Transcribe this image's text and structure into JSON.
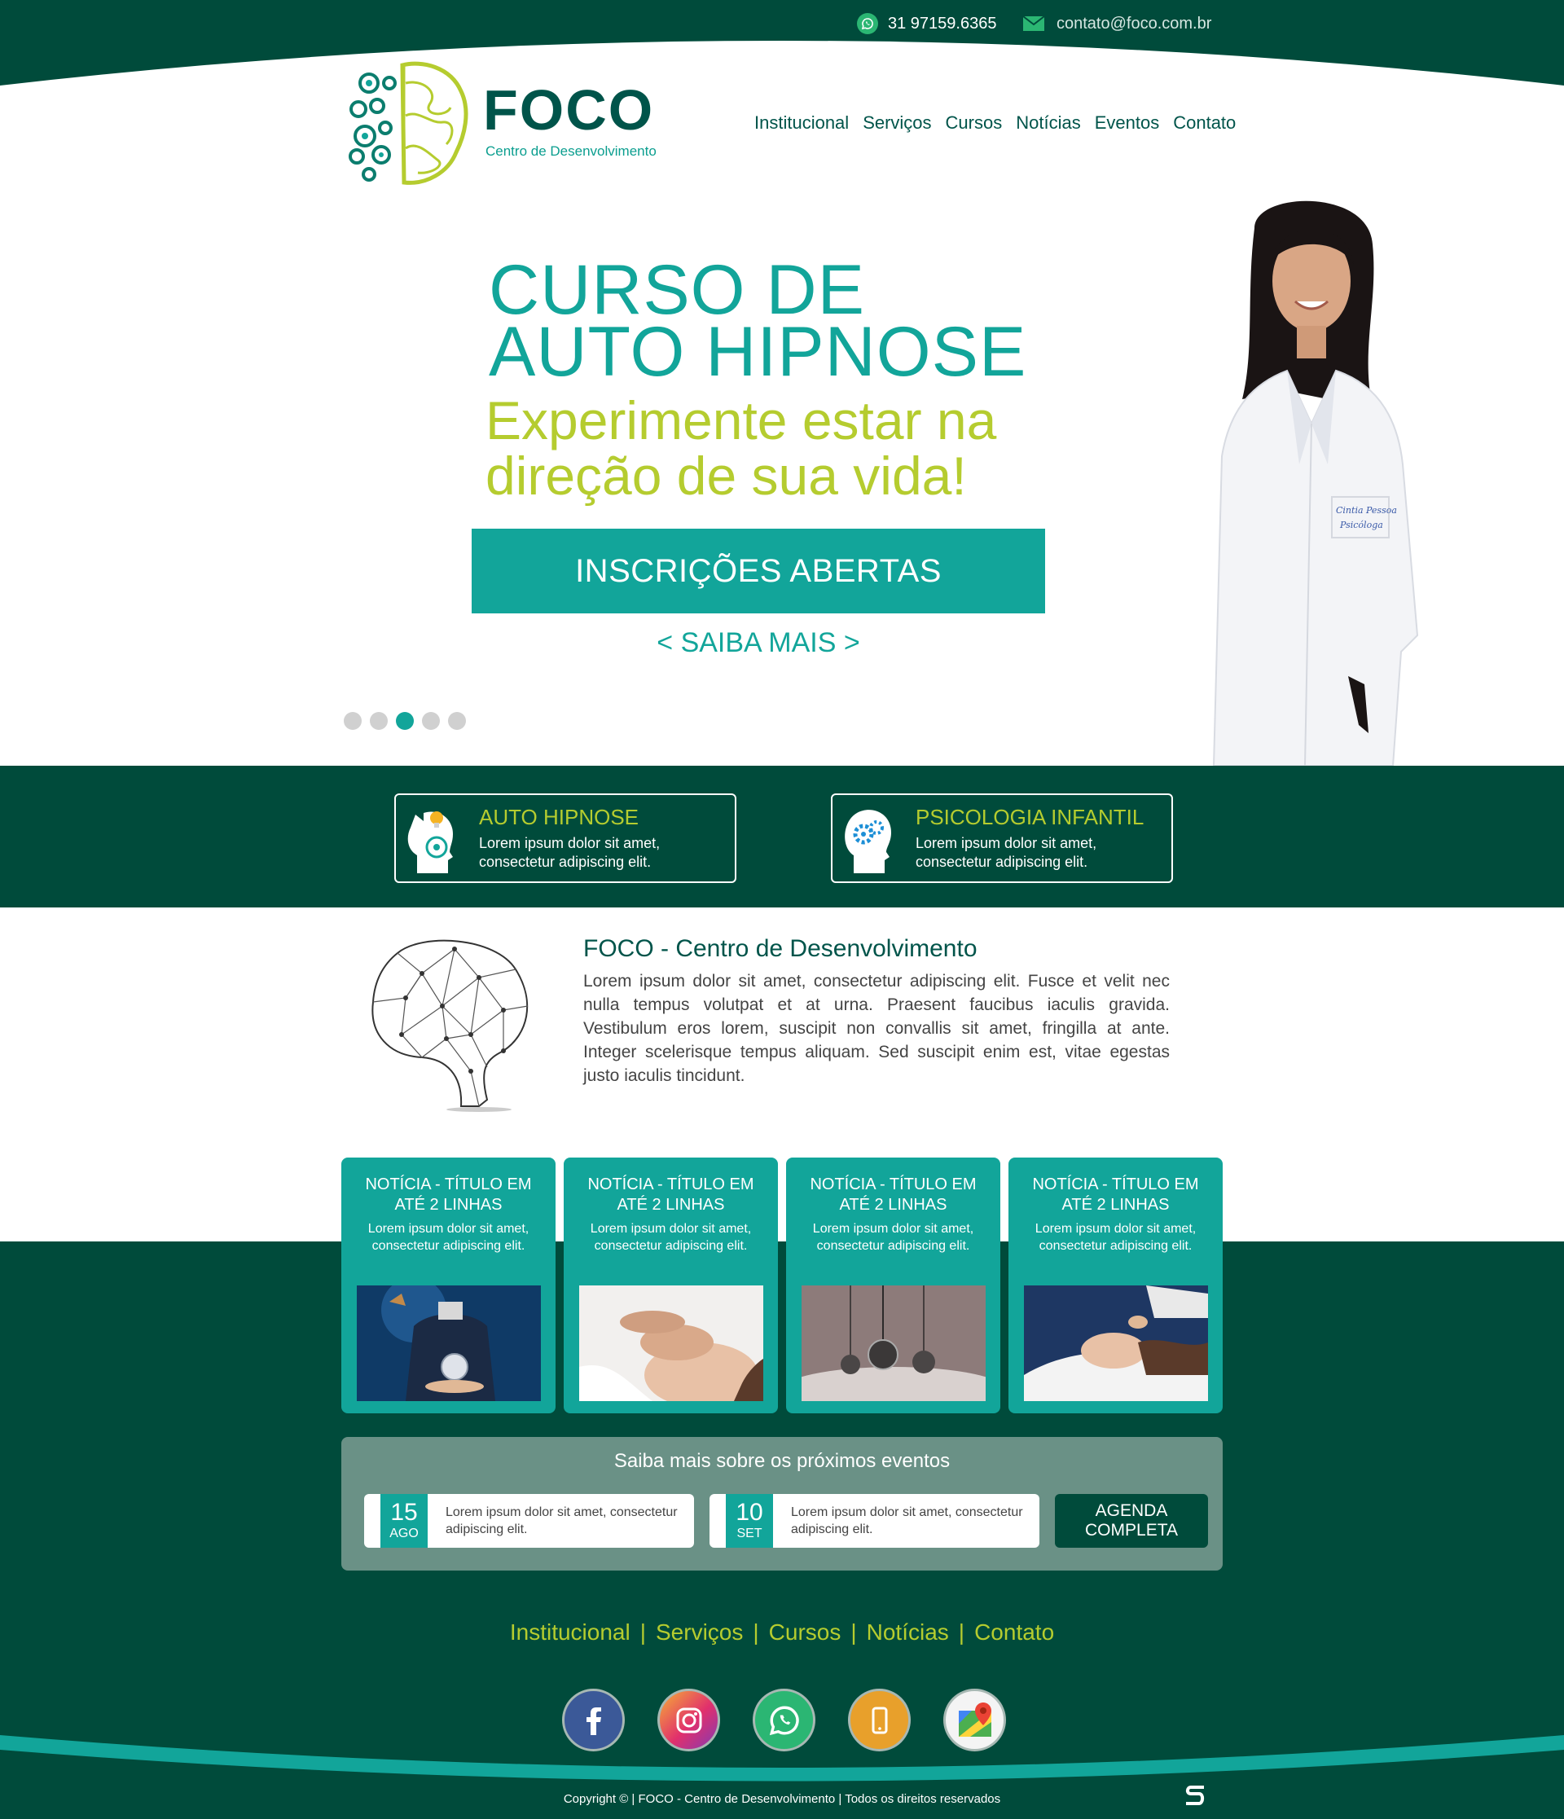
{
  "topbar": {
    "phone": "31 97159.6365",
    "email": "contato@foco.com.br",
    "phone_icon": "whatsapp-icon",
    "email_icon": "mail-icon"
  },
  "brand": {
    "name": "FOCO",
    "tagline": "Centro de Desenvolvimento"
  },
  "nav": {
    "items": [
      "Institucional",
      "Serviços",
      "Cursos",
      "Notícias",
      "Eventos",
      "Contato"
    ]
  },
  "hero": {
    "title_line1": "CURSO DE",
    "title_line2": "AUTO HIPNOSE",
    "subtitle_line1": "Experimente estar na",
    "subtitle_line2": "direção de sua vida!",
    "cta": "INSCRIÇÕES ABERTAS",
    "link": "< SAIBA MAIS >",
    "slides_total": 5,
    "slide_active": 3,
    "coat_name": "Cintia Pessoa",
    "coat_role": "Psicóloga"
  },
  "services": [
    {
      "title": "AUTO HIPNOSE",
      "text": "Lorem ipsum dolor sit amet, consectetur adipiscing elit.",
      "icon": "head-lightbulb-icon"
    },
    {
      "title": "PSICOLOGIA INFANTIL",
      "text": "Lorem ipsum dolor sit amet, consectetur adipiscing elit.",
      "icon": "head-gears-icon"
    }
  ],
  "about": {
    "title": "FOCO - Centro de Desenvolvimento",
    "text": "Lorem ipsum dolor sit amet, consectetur adipiscing elit. Fusce et velit nec nulla tempus volutpat et at urna. Praesent faucibus iaculis gravida. Vestibulum eros lorem, suscipit non convallis sit amet, fringilla at ante. Integer scelerisque tempus aliquam. Sed suscipit enim est, vitae egestas justo iaculis tincidunt."
  },
  "news": [
    {
      "title": "NOTÍCIA - TÍTULO EM ATÉ 2 LINHAS",
      "text": "Lorem ipsum dolor sit amet, consectetur adipiscing elit."
    },
    {
      "title": "NOTÍCIA - TÍTULO EM ATÉ 2 LINHAS",
      "text": "Lorem ipsum dolor sit amet, consectetur adipiscing elit."
    },
    {
      "title": "NOTÍCIA - TÍTULO EM ATÉ 2 LINHAS",
      "text": "Lorem ipsum dolor sit amet, consectetur adipiscing elit."
    },
    {
      "title": "NOTÍCIA - TÍTULO EM ATÉ 2 LINHAS",
      "text": "Lorem ipsum dolor sit amet, consectetur adipiscing elit."
    }
  ],
  "events": {
    "title": "Saiba mais sobre os próximos eventos",
    "items": [
      {
        "day": "15",
        "month": "AGO",
        "text": "Lorem ipsum dolor sit amet, consectetur adipiscing elit."
      },
      {
        "day": "10",
        "month": "SET",
        "text": "Lorem ipsum dolor sit amet, consectetur adipiscing elit."
      }
    ],
    "agenda": "AGENDA COMPLETA"
  },
  "footer": {
    "nav": [
      "Institucional",
      "Serviços",
      "Cursos",
      "Notícias",
      "Contato"
    ],
    "separator": "|",
    "social": [
      "facebook-icon",
      "instagram-icon",
      "whatsapp-icon",
      "phone-icon",
      "google-maps-icon"
    ],
    "copyright": "Copyright © | FOCO - Centro de Desenvolvimento | Todos os direitos reservados"
  },
  "colors": {
    "dark_green": "#004b3b",
    "teal": "#12a59a",
    "lime": "#b5cc2f",
    "event_panel": "#6a9186"
  }
}
